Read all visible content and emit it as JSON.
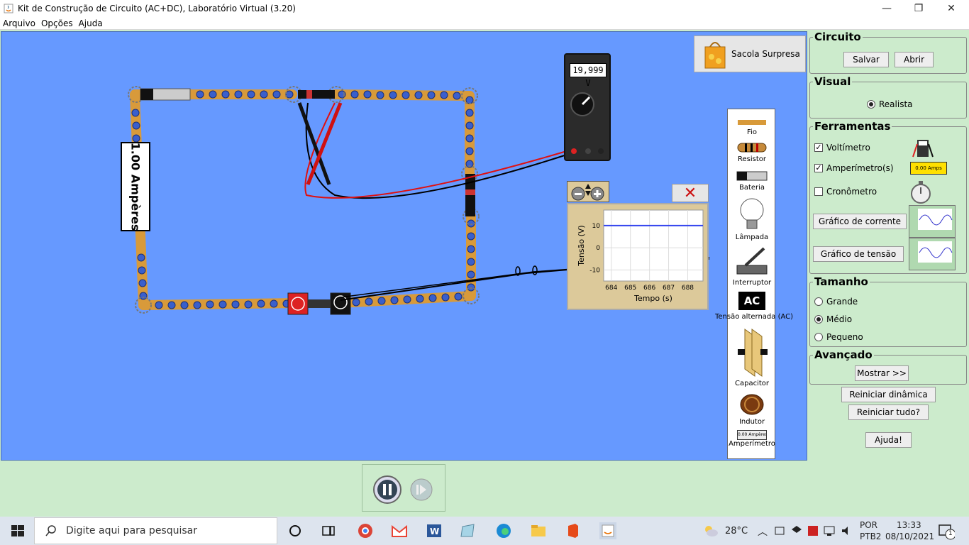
{
  "window": {
    "title": "Kit de Construção de Circuito (AC+DC), Laboratório Virtual (3.20)",
    "minimize_glyph": "—",
    "maximize_glyph": "❐",
    "close_glyph": "✕"
  },
  "menu": {
    "items": [
      "Arquivo",
      "Opções",
      "Ajuda"
    ]
  },
  "sacola": {
    "label": "Sacola Surpresa"
  },
  "meter": {
    "reading": "19,999 V"
  },
  "ampere_label": "1.00 Ampères",
  "toolbox": {
    "items": [
      {
        "label": "Fio",
        "icon": "wire-icon"
      },
      {
        "label": "Resistor",
        "icon": "resistor-icon"
      },
      {
        "label": "Bateria",
        "icon": "battery-icon"
      },
      {
        "label": "Lâmpada",
        "icon": "bulb-icon"
      },
      {
        "label": "Interruptor",
        "icon": "switch-icon"
      },
      {
        "label": "Tensão alternada (AC)",
        "icon": "ac-source-icon",
        "glyph": "AC"
      },
      {
        "label": "Capacitor",
        "icon": "capacitor-icon"
      },
      {
        "label": "Indutor",
        "icon": "inductor-icon"
      },
      {
        "label": "Amperímetro",
        "icon": "ammeter-icon",
        "glyph": "0.00 Ampères"
      }
    ]
  },
  "graph": {
    "chart_data": {
      "type": "line",
      "ylabel": "Tensão (V)",
      "xlabel": "Tempo (s)",
      "x_ticks": [
        "684",
        "685",
        "686",
        "687",
        "688"
      ],
      "y_ticks": [
        "10",
        "0",
        "-10"
      ],
      "xlim": [
        683.6,
        688.8
      ],
      "ylim": [
        -15,
        17
      ],
      "series": [
        {
          "x": [
            683.6,
            688.8
          ],
          "y": [
            10,
            10
          ],
          "color": "#3344ee"
        }
      ]
    }
  },
  "panel": {
    "circuito": {
      "title": "Circuito",
      "save": "Salvar",
      "open": "Abrir"
    },
    "visual": {
      "title": "Visual",
      "option": "Realista"
    },
    "ferramentas": {
      "title": "Ferramentas",
      "voltmeter": "Voltímetro",
      "ammeter": "Amperímetro(s)",
      "chronometer": "Cronômetro",
      "current_graph": "Gráfico de corrente",
      "voltage_graph": "Gráfico de tensão",
      "ammeter_thumb_text": "0.00 Amps"
    },
    "tamanho": {
      "title": "Tamanho",
      "options": [
        "Grande",
        "Médio",
        "Pequeno"
      ],
      "selected": "Médio"
    },
    "avancado": {
      "title": "Avançado",
      "show": "Mostrar >>"
    },
    "reset_dynamic": "Reiniciar dinâmica",
    "reset_all": "Reiniciar tudo?",
    "help": "Ajuda!"
  },
  "taskbar": {
    "search_placeholder": "Digite aqui para pesquisar",
    "weather": "28°C",
    "language": "POR",
    "layout": "PTB2",
    "time": "13:33",
    "date": "08/10/2021",
    "notification_count": "1"
  }
}
